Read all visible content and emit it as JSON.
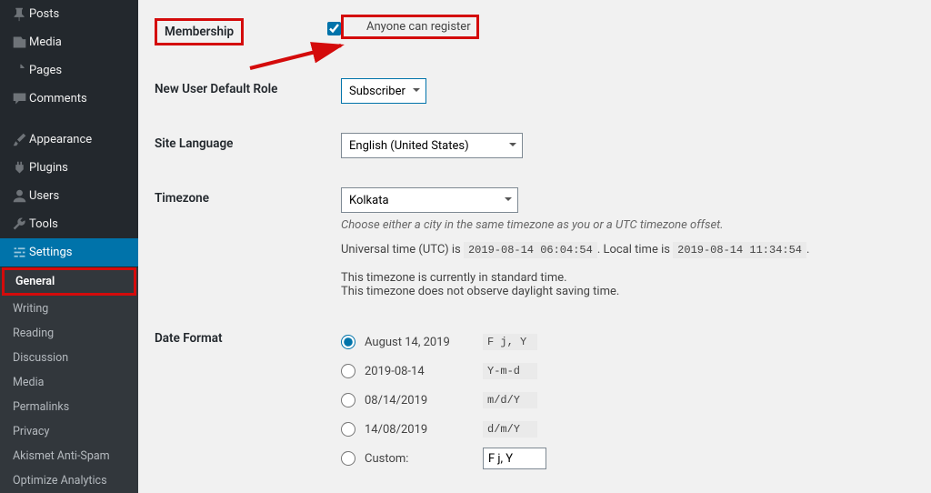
{
  "sidebar": {
    "items": [
      {
        "label": "Posts"
      },
      {
        "label": "Media"
      },
      {
        "label": "Pages"
      },
      {
        "label": "Comments"
      },
      {
        "label": "Appearance"
      },
      {
        "label": "Plugins"
      },
      {
        "label": "Users"
      },
      {
        "label": "Tools"
      },
      {
        "label": "Settings"
      }
    ],
    "sub": [
      {
        "label": "General"
      },
      {
        "label": "Writing"
      },
      {
        "label": "Reading"
      },
      {
        "label": "Discussion"
      },
      {
        "label": "Media"
      },
      {
        "label": "Permalinks"
      },
      {
        "label": "Privacy"
      },
      {
        "label": "Akismet Anti-Spam"
      },
      {
        "label": "Optimize Analytics"
      }
    ]
  },
  "form": {
    "membership": {
      "label": "Membership",
      "checkbox_label": "Anyone can register"
    },
    "newuser": {
      "label": "New User Default Role",
      "value": "Subscriber"
    },
    "language": {
      "label": "Site Language",
      "value": "English (United States)"
    },
    "timezone": {
      "label": "Timezone",
      "value": "Kolkata",
      "desc": "Choose either a city in the same timezone as you or a UTC timezone offset.",
      "utc_pre": "Universal time (UTC) is ",
      "utc_val": "2019-08-14 06:04:54",
      "local_pre": ". Local time is ",
      "local_val": "2019-08-14 11:34:54",
      "end": ".",
      "info1": "This timezone is currently in standard time.",
      "info2": "This timezone does not observe daylight saving time."
    },
    "dateformat": {
      "label": "Date Format",
      "options": [
        {
          "label": "August 14, 2019",
          "code": "F j, Y"
        },
        {
          "label": "2019-08-14",
          "code": "Y-m-d"
        },
        {
          "label": "08/14/2019",
          "code": "m/d/Y"
        },
        {
          "label": "14/08/2019",
          "code": "d/m/Y"
        }
      ],
      "custom_label": "Custom:",
      "custom_value": "F j, Y"
    }
  }
}
